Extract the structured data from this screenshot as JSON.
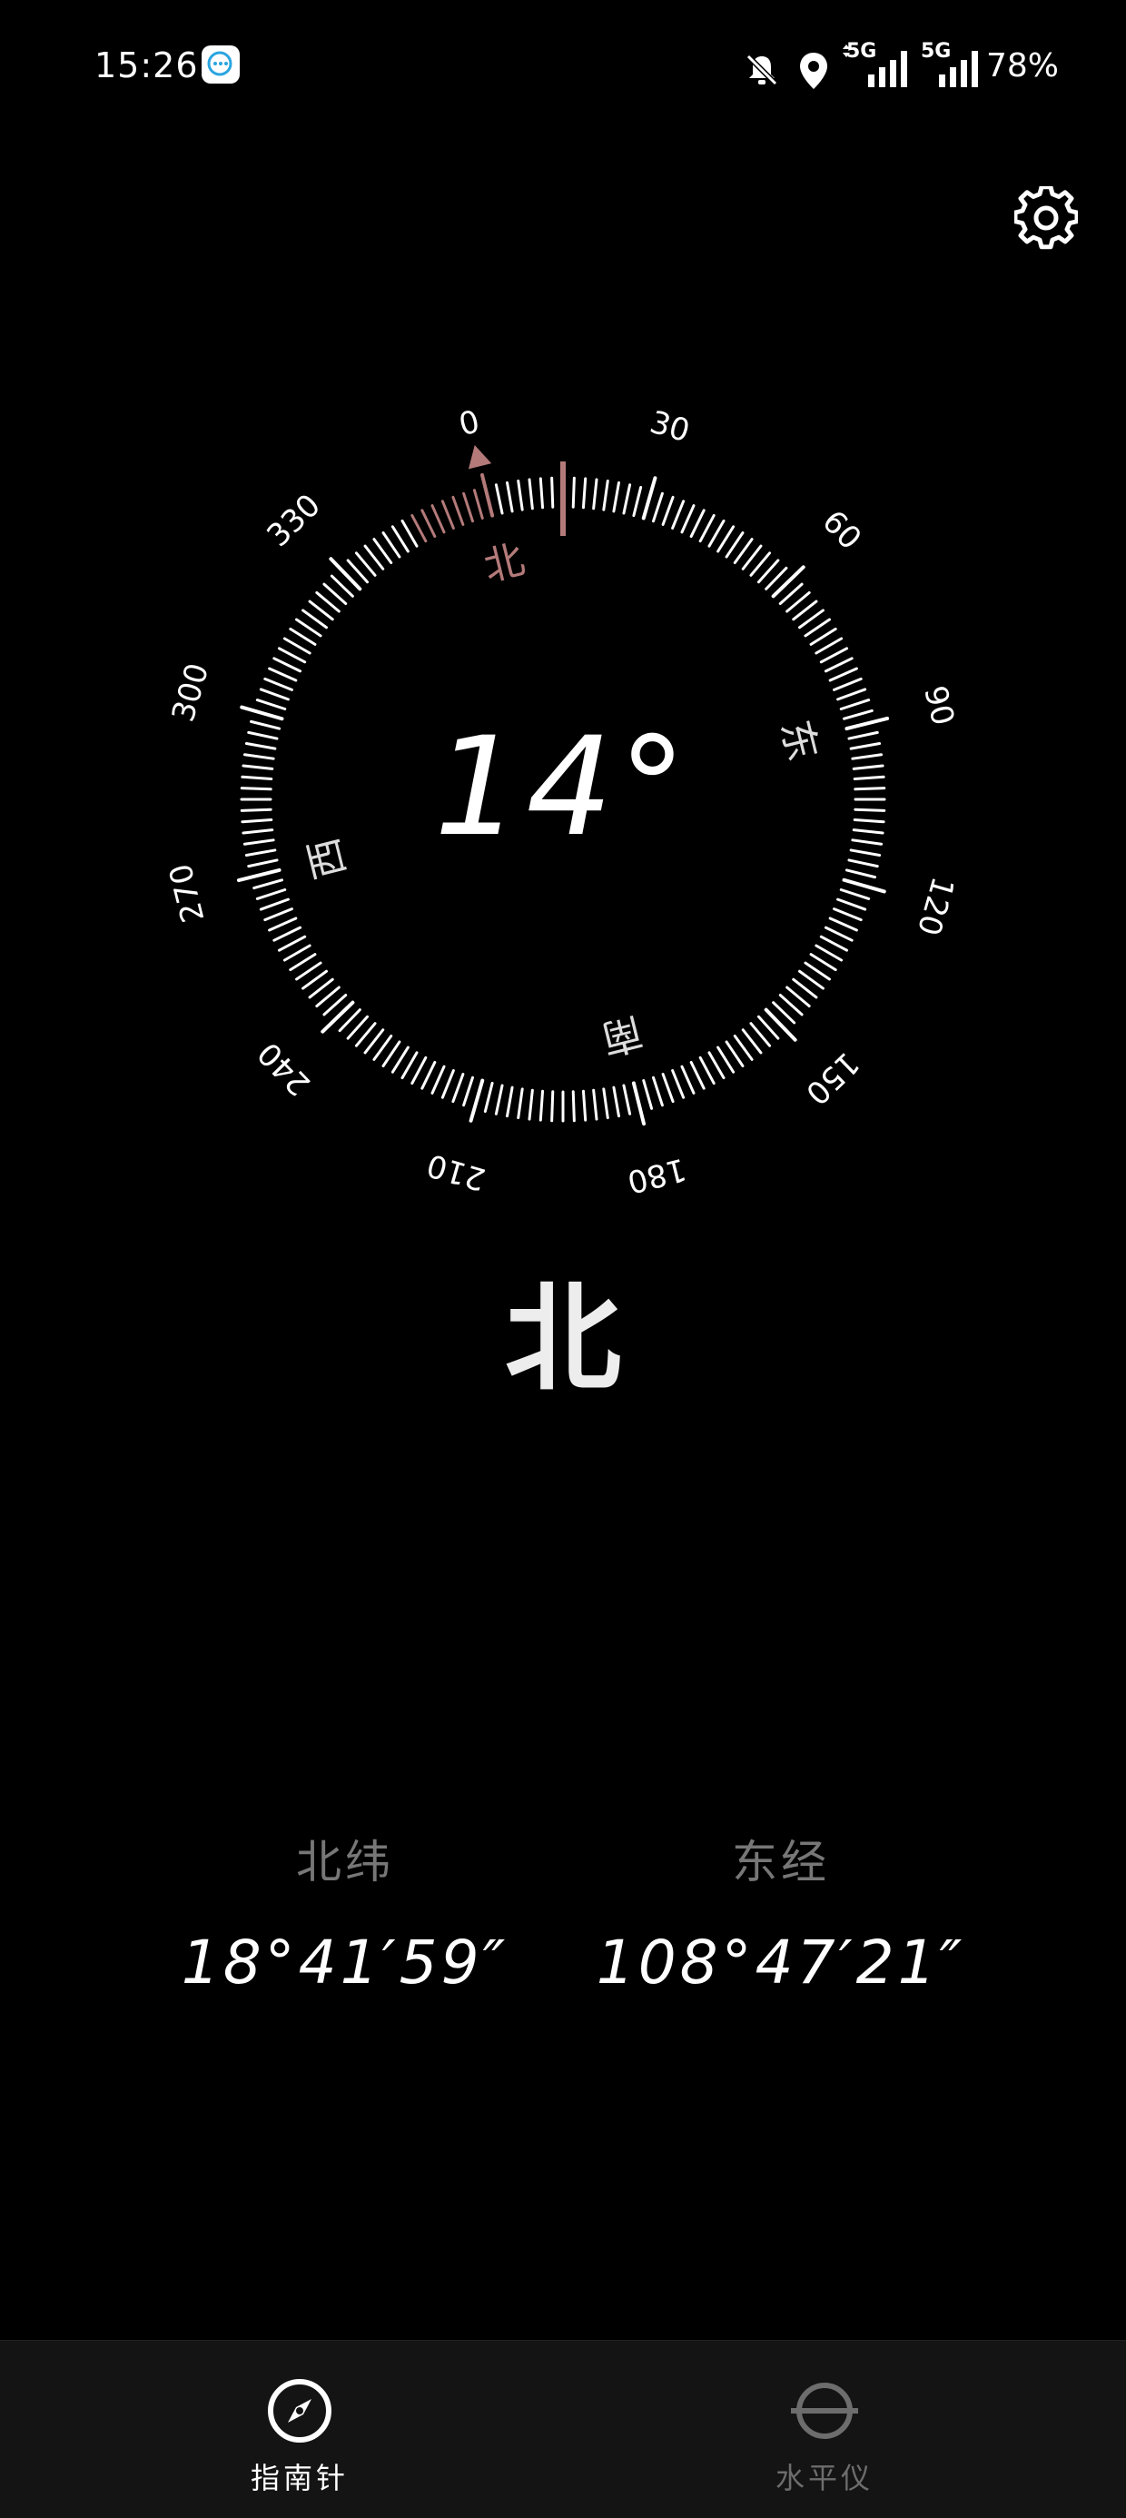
{
  "status_bar": {
    "time": "15:26",
    "battery": "78%",
    "icons": [
      "chat-app-icon",
      "mute-bell-icon",
      "location-pin-icon",
      "signal-5g-icon",
      "signal-5g-icon"
    ],
    "network_labels": [
      "5G",
      "5G"
    ]
  },
  "compass": {
    "heading": "14°",
    "direction": "北",
    "dial_numbers": [
      "0",
      "30",
      "60",
      "90",
      "120",
      "150",
      "180",
      "210",
      "240",
      "270",
      "300",
      "330"
    ],
    "cardinals": {
      "north": "北",
      "east": "东",
      "south": "南",
      "west": "西"
    },
    "heading_degrees": 14,
    "accent_color": "#b47a7a"
  },
  "coordinates": {
    "latitude_label": "北纬",
    "latitude_value": "18°41′59″",
    "longitude_label": "东经",
    "longitude_value": "108°47′21″"
  },
  "nav": {
    "compass_label": "指南针",
    "level_label": "水平仪",
    "active": "compass"
  }
}
